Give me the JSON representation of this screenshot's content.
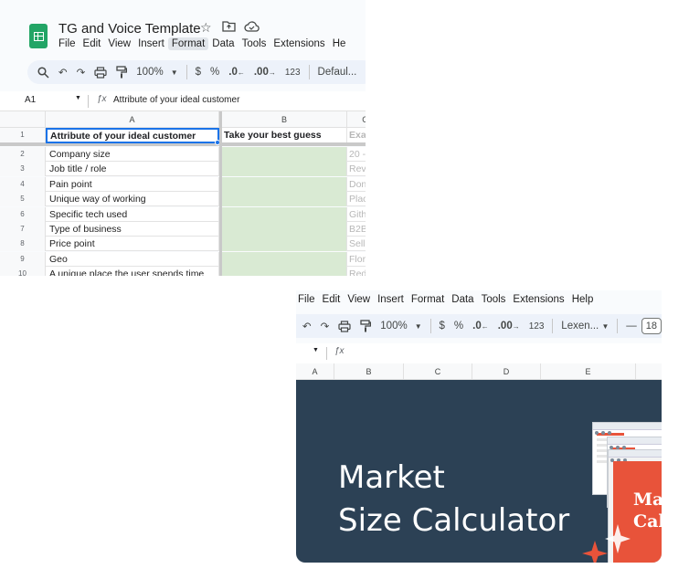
{
  "window1": {
    "title": "TG and Voice Template",
    "menu": [
      "File",
      "Edit",
      "View",
      "Insert",
      "Format",
      "Data",
      "Tools",
      "Extensions",
      "He"
    ],
    "toolbar": {
      "zoom": "100%",
      "currency": "$",
      "percent": "%",
      "dec_less": ".0",
      "dec_more": ".00",
      "number_format": "123",
      "font": "Defaul..."
    },
    "cell_ref": "A1",
    "formula": "Attribute of your ideal customer",
    "columns": [
      "A",
      "B",
      "C"
    ],
    "header_row": {
      "num": "1",
      "a": "Attribute of your ideal customer",
      "b": "Take your best guess",
      "c": "Exa"
    },
    "rows": [
      {
        "num": "2",
        "a": "Company size",
        "c": "20 -"
      },
      {
        "num": "3",
        "a": "Job title / role",
        "c": "Rev"
      },
      {
        "num": "4",
        "a": "Pain point",
        "c": "Don"
      },
      {
        "num": "5",
        "a": "Unique way of working",
        "c": "Plac"
      },
      {
        "num": "6",
        "a": "Specific tech used",
        "c": "Gith"
      },
      {
        "num": "7",
        "a": "Type of business",
        "c": "B2B"
      },
      {
        "num": "8",
        "a": "Price point",
        "c": "Sell"
      },
      {
        "num": "9",
        "a": "Geo",
        "c": "Flor"
      },
      {
        "num": "10",
        "a": "A unique place the user spends time",
        "c": "Red"
      }
    ]
  },
  "window2": {
    "menu": [
      "File",
      "Edit",
      "View",
      "Insert",
      "Format",
      "Data",
      "Tools",
      "Extensions",
      "Help"
    ],
    "toolbar": {
      "zoom": "100%",
      "currency": "$",
      "percent": "%",
      "dec_less": ".0",
      "dec_more": ".00",
      "number_format": "123",
      "font": "Lexen...",
      "minus": "—",
      "font_size": "18"
    },
    "columns": [
      "A",
      "B",
      "C",
      "D",
      "E"
    ],
    "hero": {
      "line1": "Market",
      "line2": "Size Calculator",
      "card_text": [
        "Mar",
        "Cal"
      ]
    }
  },
  "colors": {
    "sheets_green": "#23a566",
    "guess_fill": "#d9ead3",
    "hero_bg": "#2c4155",
    "accent_orange": "#e8533a"
  }
}
